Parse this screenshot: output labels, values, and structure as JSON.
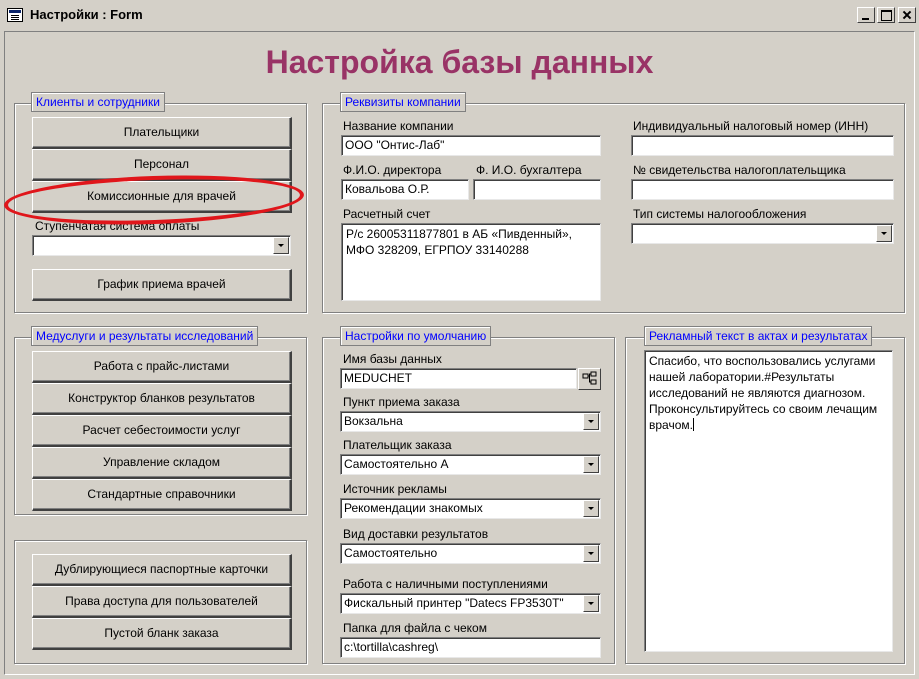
{
  "window": {
    "title": "Настройки : Form"
  },
  "heading": "Настройка базы данных",
  "clients": {
    "legend": "Клиенты и сотрудники",
    "buttons": [
      "Плательщики",
      "Персонал",
      "Комиссионные для врачей"
    ],
    "payment_system_label": "Ступенчатая система оплаты",
    "payment_system_value": "",
    "schedule_button": "График приема врачей"
  },
  "company": {
    "legend": "Реквизиты компании",
    "name_label": "Название компании",
    "name_value": "ООО \"Онтис-Лаб\"",
    "director_label": "Ф.И.О. директора",
    "director_value": "Ковальова О.Р.",
    "accountant_label": "Ф. И.О. бухгалтера",
    "accountant_value": "",
    "account_label": "Расчетный счет",
    "account_value": "Р/с 26005311877801 в АБ «Пивденный», МФО 328209, ЕГРПОУ 33140288",
    "inn_label": "Индивидуальный налоговый номер (ИНН)",
    "inn_value": "",
    "certificate_label": "№ свидетельства налогоплательщика",
    "certificate_value": "",
    "tax_system_label": "Тип системы налогообложения",
    "tax_system_value": ""
  },
  "medservices": {
    "legend": "Медуслуги и результаты исследований",
    "buttons": [
      "Работа с прайс-листами",
      "Конструктор бланков результатов",
      "Расчет себестоимости услуг",
      "Управление складом",
      "Стандартные справочники"
    ]
  },
  "misc": {
    "buttons": [
      "Дублирующиеся паспортные карточки",
      "Права доступа для пользователей",
      "Пустой бланк заказа"
    ]
  },
  "defaults": {
    "legend": "Настройки по умолчанию",
    "db_name_label": "Имя базы данных",
    "db_name_value": "MEDUCHET",
    "pickup_label": "Пункт приема заказа",
    "pickup_value": "Вокзальна",
    "payer_label": "Плательщик заказа",
    "payer_value": "Самостоятельно А",
    "ad_source_label": "Источник рекламы",
    "ad_source_value": "Рекомендации знакомых",
    "delivery_label": "Вид доставки результатов",
    "delivery_value": "Самостоятельно",
    "cash_label": "Работа с наличными поступлениями",
    "cash_value": "Фискальный принтер \"Datecs FP3530T\"",
    "folder_label": "Папка для файла с чеком",
    "folder_value": "c:\\tortilla\\cashreg\\"
  },
  "ad_text": {
    "legend": "Рекламный текст в актах и результатах",
    "value": "Спасибо, что воспользовались услугами нашей лаборатории.#Результаты исследований не являются диагнозом. Проконсультируйтесь со своим лечащим врачом."
  }
}
